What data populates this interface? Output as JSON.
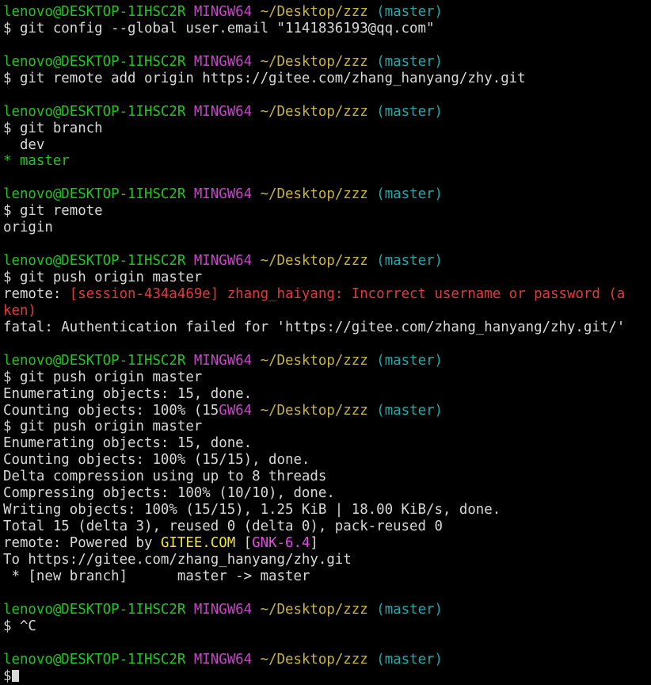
{
  "colors": {
    "default": "#d8d8d8",
    "user": "#21c521",
    "system": "#c846c8",
    "path": "#c8b43c",
    "branch": "#1faaaa",
    "error": "#e23a3a",
    "highlight": "#f0e630",
    "tag": "#e44ae4",
    "background": "#000000"
  },
  "cursor_icon": "block-cursor",
  "lines": [
    [
      {
        "t": "lenovo@DESKTOP-1IHSC2R",
        "c": "user"
      },
      {
        "t": " "
      },
      {
        "t": "MINGW64",
        "c": "system"
      },
      {
        "t": " "
      },
      {
        "t": "~/Desktop/zzz",
        "c": "path"
      },
      {
        "t": " "
      },
      {
        "t": "(master)",
        "c": "branch"
      }
    ],
    [
      {
        "t": "$ git config --global user.email \"1141836193@qq.com\""
      }
    ],
    [],
    [
      {
        "t": "lenovo@DESKTOP-1IHSC2R",
        "c": "user"
      },
      {
        "t": " "
      },
      {
        "t": "MINGW64",
        "c": "system"
      },
      {
        "t": " "
      },
      {
        "t": "~/Desktop/zzz",
        "c": "path"
      },
      {
        "t": " "
      },
      {
        "t": "(master)",
        "c": "branch"
      }
    ],
    [
      {
        "t": "$ git remote add origin https://gitee.com/zhang_hanyang/zhy.git"
      }
    ],
    [],
    [
      {
        "t": "lenovo@DESKTOP-1IHSC2R",
        "c": "user"
      },
      {
        "t": " "
      },
      {
        "t": "MINGW64",
        "c": "system"
      },
      {
        "t": " "
      },
      {
        "t": "~/Desktop/zzz",
        "c": "path"
      },
      {
        "t": " "
      },
      {
        "t": "(master)",
        "c": "branch"
      }
    ],
    [
      {
        "t": "$ git branch"
      }
    ],
    [
      {
        "t": "  dev"
      }
    ],
    [
      {
        "t": "* master",
        "c": "user"
      }
    ],
    [],
    [
      {
        "t": "lenovo@DESKTOP-1IHSC2R",
        "c": "user"
      },
      {
        "t": " "
      },
      {
        "t": "MINGW64",
        "c": "system"
      },
      {
        "t": " "
      },
      {
        "t": "~/Desktop/zzz",
        "c": "path"
      },
      {
        "t": " "
      },
      {
        "t": "(master)",
        "c": "branch"
      }
    ],
    [
      {
        "t": "$ git remote"
      }
    ],
    [
      {
        "t": "origin"
      }
    ],
    [],
    [
      {
        "t": "lenovo@DESKTOP-1IHSC2R",
        "c": "user"
      },
      {
        "t": " "
      },
      {
        "t": "MINGW64",
        "c": "system"
      },
      {
        "t": " "
      },
      {
        "t": "~/Desktop/zzz",
        "c": "path"
      },
      {
        "t": " "
      },
      {
        "t": "(master)",
        "c": "branch"
      }
    ],
    [
      {
        "t": "$ git push origin master"
      }
    ],
    [
      {
        "t": "remote: "
      },
      {
        "t": "[session-434a469e] zhang_haiyang: Incorrect username or password (a",
        "c": "error"
      }
    ],
    [
      {
        "t": "ken)",
        "c": "error"
      }
    ],
    [
      {
        "t": "fatal: Authentication failed for 'https://gitee.com/zhang_hanyang/zhy.git/'"
      }
    ],
    [],
    [
      {
        "t": "lenovo@DESKTOP-1IHSC2R",
        "c": "user"
      },
      {
        "t": " "
      },
      {
        "t": "MINGW64",
        "c": "system"
      },
      {
        "t": " "
      },
      {
        "t": "~/Desktop/zzz",
        "c": "path"
      },
      {
        "t": " "
      },
      {
        "t": "(master)",
        "c": "branch"
      }
    ],
    [
      {
        "t": "$ git push origin master"
      }
    ],
    [
      {
        "t": "Enumerating objects: 15, done."
      }
    ],
    [
      {
        "t": "Counting objects: 100% (15"
      },
      {
        "t": "GW64",
        "c": "system"
      },
      {
        "t": " "
      },
      {
        "t": "~/Desktop/zzz",
        "c": "path"
      },
      {
        "t": " "
      },
      {
        "t": "(master)",
        "c": "branch"
      }
    ],
    [
      {
        "t": "$ git push origin master"
      }
    ],
    [
      {
        "t": "Enumerating objects: 15, done."
      }
    ],
    [
      {
        "t": "Counting objects: 100% (15/15), done."
      }
    ],
    [
      {
        "t": "Delta compression using up to 8 threads"
      }
    ],
    [
      {
        "t": "Compressing objects: 100% (10/10), done."
      }
    ],
    [
      {
        "t": "Writing objects: 100% (15/15), 1.25 KiB | 18.00 KiB/s, done."
      }
    ],
    [
      {
        "t": "Total 15 (delta 3), reused 0 (delta 0), pack-reused 0"
      }
    ],
    [
      {
        "t": "remote: Powered by "
      },
      {
        "t": "GITEE.COM",
        "c": "highlight"
      },
      {
        "t": " ["
      },
      {
        "t": "GNK-6.4",
        "c": "tag"
      },
      {
        "t": "]"
      }
    ],
    [
      {
        "t": "To https://gitee.com/zhang_hanyang/zhy.git"
      }
    ],
    [
      {
        "t": " * [new branch]      master -> master"
      }
    ],
    [],
    [
      {
        "t": "lenovo@DESKTOP-1IHSC2R",
        "c": "user"
      },
      {
        "t": " "
      },
      {
        "t": "MINGW64",
        "c": "system"
      },
      {
        "t": " "
      },
      {
        "t": "~/Desktop/zzz",
        "c": "path"
      },
      {
        "t": " "
      },
      {
        "t": "(master)",
        "c": "branch"
      }
    ],
    [
      {
        "t": "$ ^C"
      }
    ],
    [],
    [
      {
        "t": "lenovo@DESKTOP-1IHSC2R",
        "c": "user"
      },
      {
        "t": " "
      },
      {
        "t": "MINGW64",
        "c": "system"
      },
      {
        "t": " "
      },
      {
        "t": "~/Desktop/zzz",
        "c": "path"
      },
      {
        "t": " "
      },
      {
        "t": "(master)",
        "c": "branch"
      }
    ],
    [
      {
        "t": "$"
      }
    ]
  ]
}
